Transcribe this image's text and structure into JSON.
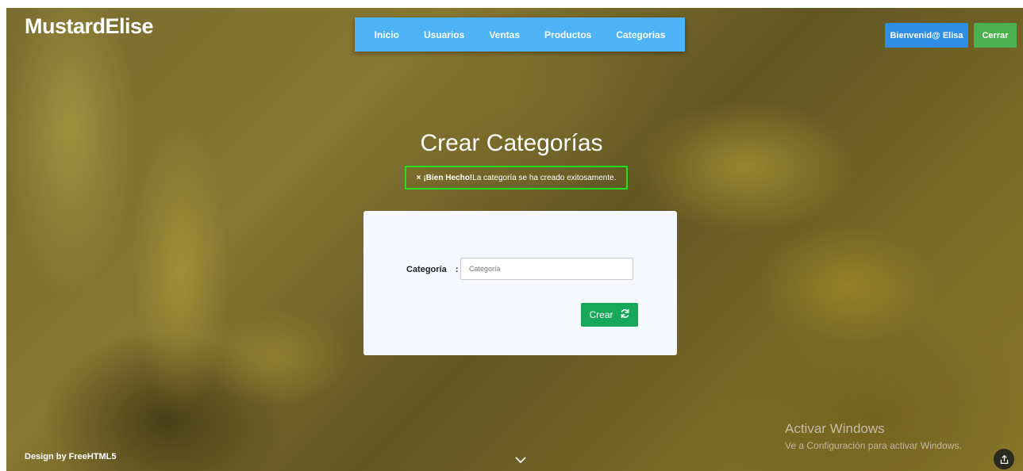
{
  "brand": "MustardElise",
  "nav": {
    "items": [
      {
        "label": "Inicio"
      },
      {
        "label": "Usuarios"
      },
      {
        "label": "Ventas"
      },
      {
        "label": "Productos"
      },
      {
        "label": "Categorias"
      }
    ]
  },
  "header": {
    "welcome_label": "Bienvenid@ Elisa",
    "close_label": "Cerrar"
  },
  "page": {
    "title": "Crear Categorías"
  },
  "alert": {
    "close_glyph": "×",
    "strong": "¡Bien Hecho!",
    "message": "La categoría se ha creado exitosamente."
  },
  "form": {
    "label": "Categoría",
    "separator": ":",
    "placeholder": "Categoría",
    "value": "",
    "submit_label": "Crear",
    "submit_icon": "refresh-icon"
  },
  "footer": {
    "credit": "Design by FreeHTML5",
    "scroll_icon": "chevron-down-icon"
  },
  "watermark": {
    "title": "Activar Windows",
    "subtitle": "Ve a Configuración para activar Windows."
  },
  "colors": {
    "nav_bg": "#4db3f5",
    "welcome_bg": "#2f8ee5",
    "close_bg": "#4caf50",
    "create_bg": "#17a85a",
    "alert_border": "#22dd22"
  }
}
